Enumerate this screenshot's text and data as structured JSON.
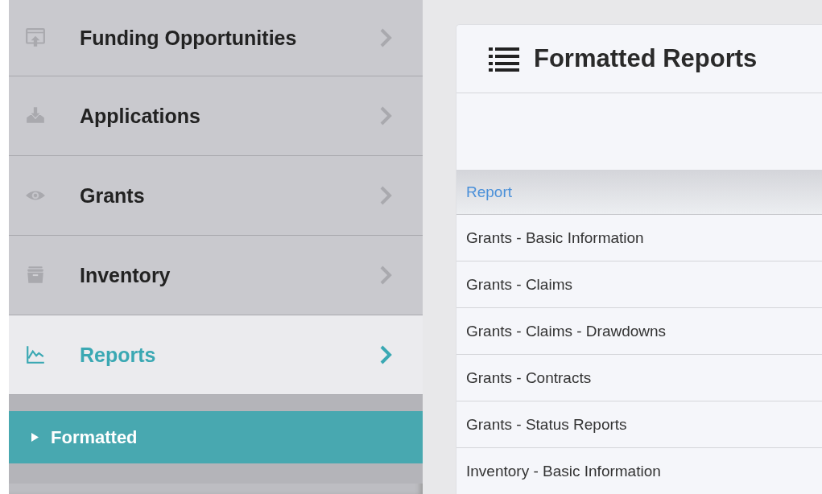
{
  "sidebar": {
    "items": [
      {
        "label": "Funding Opportunities",
        "selected": false
      },
      {
        "label": "Applications",
        "selected": false
      },
      {
        "label": "Grants",
        "selected": false
      },
      {
        "label": "Inventory",
        "selected": false
      },
      {
        "label": "Reports",
        "selected": true,
        "expanded": true,
        "children": [
          {
            "label": "Formatted",
            "selected": true
          }
        ]
      }
    ]
  },
  "panel": {
    "title": "Formatted Reports",
    "table": {
      "columns": [
        "Report"
      ],
      "rows": [
        "Grants - Basic Information",
        "Grants - Claims",
        "Grants - Claims - Drawdowns",
        "Grants - Contracts",
        "Grants - Status Reports",
        "Inventory - Basic Information"
      ]
    }
  }
}
